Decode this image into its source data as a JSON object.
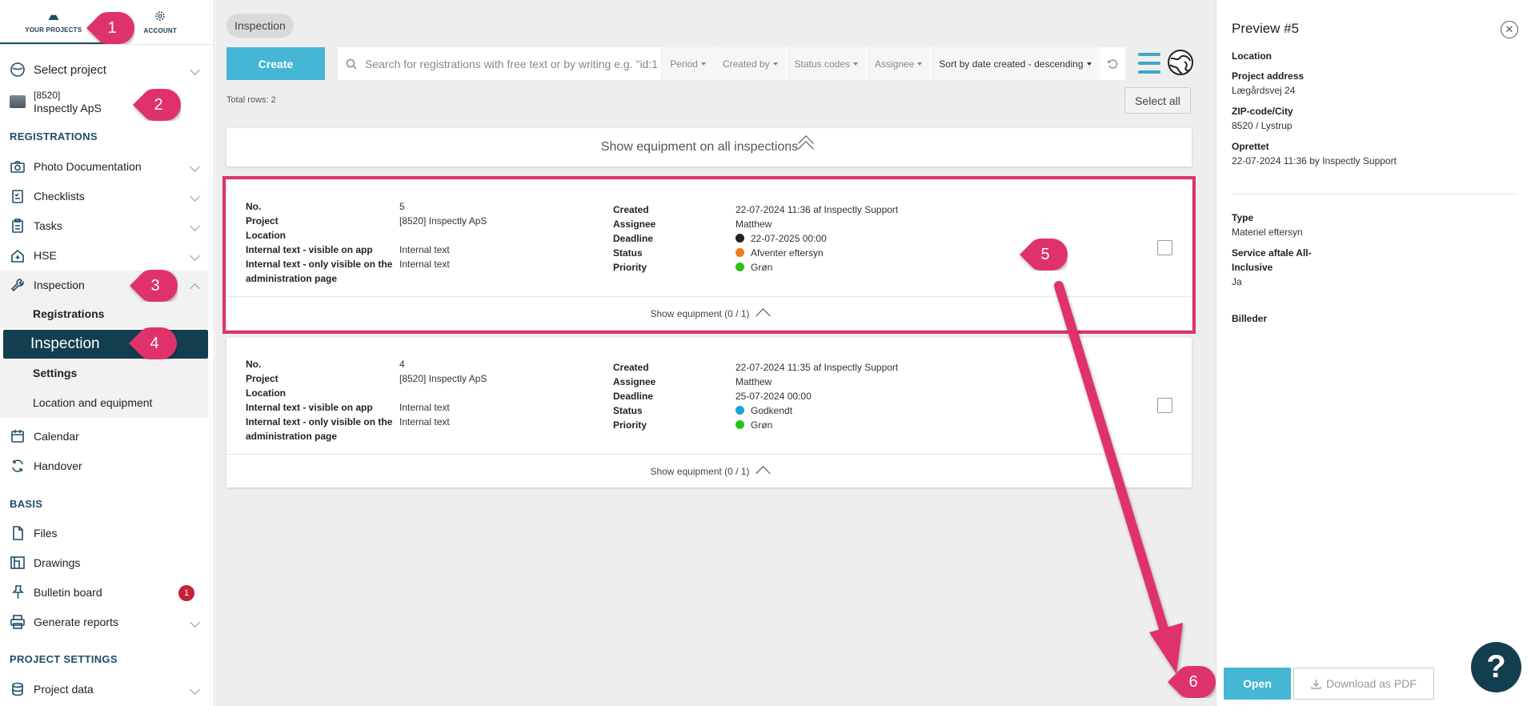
{
  "sidebar": {
    "tabs": [
      {
        "label": "YOUR PROJECTS",
        "icon": "hardhat-icon"
      },
      {
        "label": "ACCOUNT",
        "icon": "gear-icon"
      }
    ],
    "select_project": "Select project",
    "project_code": "[8520]",
    "project_name": "Inspectly ApS",
    "sections": {
      "registrations": "REGISTRATIONS",
      "basis": "BASIS",
      "project_settings": "PROJECT SETTINGS"
    },
    "items": {
      "photo_documentation": "Photo Documentation",
      "checklists": "Checklists",
      "tasks": "Tasks",
      "hse": "HSE",
      "inspection": "Inspection",
      "calendar": "Calendar",
      "handover": "Handover",
      "files": "Files",
      "drawings": "Drawings",
      "bulletin_board": "Bulletin board",
      "generate_reports": "Generate reports",
      "project_data": "Project data"
    },
    "inspection_sub": {
      "registrations": "Registrations",
      "inspection": "Inspection",
      "settings": "Settings",
      "location_equipment": "Location and equipment"
    },
    "bulletin_badge": "1"
  },
  "main": {
    "breadcrumb": "Inspection",
    "create_label": "Create",
    "search_placeholder": "Search for registrations with free text or by writing e.g. \"id:1",
    "filters": {
      "period": "Period",
      "created_by": "Created by",
      "status_codes": "Status codes",
      "assignee": "Assignee",
      "sort": "Sort by date created - descending"
    },
    "total_rows": "Total rows: 2",
    "select_all": "Select all",
    "show_equipment_all": "Show equipment on all inspections",
    "labels": {
      "no": "No.",
      "project": "Project",
      "location": "Location",
      "internal_app": "Internal text - visible on app",
      "internal_admin_1": "Internal text - only visible on the",
      "internal_admin_2": "administration page",
      "created": "Created",
      "assignee": "Assignee",
      "deadline": "Deadline",
      "status": "Status",
      "priority": "Priority"
    },
    "cards": [
      {
        "no": "5",
        "project": "[8520] Inspectly ApS",
        "location": "",
        "internal_app": "Internal text",
        "internal_admin": "Internal text",
        "created": "22-07-2024 11:36 af Inspectly Support",
        "assignee": "Matthew",
        "deadline": "22-07-2025 00:00",
        "deadline_color": "#222222",
        "status": "Afventer eftersyn",
        "status_color": "#f07a1a",
        "priority": "Grøn",
        "priority_color": "#2ac21a",
        "equipment": "Show equipment (0 / 1)"
      },
      {
        "no": "4",
        "project": "[8520] Inspectly ApS",
        "location": "",
        "internal_app": "Internal text",
        "internal_admin": "Internal text",
        "created": "22-07-2024 11:35 af Inspectly Support",
        "assignee": "Matthew",
        "deadline": "25-07-2024 00:00",
        "status": "Godkendt",
        "status_color": "#1ea3d6",
        "priority": "Grøn",
        "priority_color": "#2ac21a",
        "equipment": "Show equipment (0 / 1)"
      }
    ]
  },
  "preview": {
    "title": "Preview #5",
    "location_label": "Location",
    "address_label": "Project address",
    "address_value": "Lægårdsvej 24",
    "zip_label": "ZIP-code/City",
    "zip_value": "8520 / Lystrup",
    "created_label": "Oprettet",
    "created_value": "22-07-2024 11:36 by Inspectly Support",
    "type_label": "Type",
    "type_value": "Materiel eftersyn",
    "service_label": "Service aftale All-Inclusive",
    "service_value": "Ja",
    "images_label": "Billeder",
    "open_label": "Open",
    "pdf_label": "Download as PDF",
    "help_label": "?"
  },
  "callouts": [
    "1",
    "2",
    "3",
    "4",
    "5",
    "6"
  ],
  "colors": {
    "accent": "#45b6d4",
    "dark": "#133e4f",
    "callout": "#e0336a"
  }
}
